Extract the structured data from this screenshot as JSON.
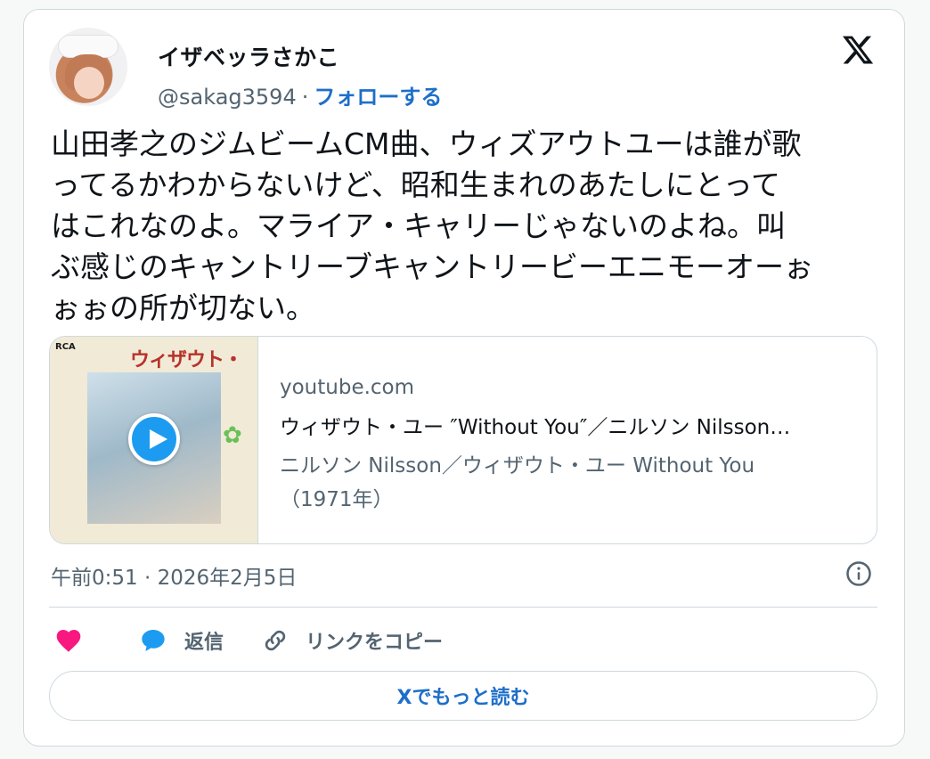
{
  "author": {
    "display_name": "イザベッラさかこ",
    "handle": "@sakag3594",
    "separator": "·",
    "follow_label": "フォローする"
  },
  "tweet": {
    "text": "山田孝之のジムビームCM曲、ウィズアウトユーは誰が歌\nってるかわからないけど、昭和生まれのあたしにとって\nはこれなのよ。マライア・キャリーじゃないのよね。叫\nぶ感じのキャントリーブキャントリービーエニモーオーぉ\nぉぉの所が切ない。",
    "timestamp": "午前0:51 · 2026年2月5日"
  },
  "link_card": {
    "domain": "youtube.com",
    "title": "ウィザウト・ユー ″Without You″／ニルソン Nilsson…",
    "description": "ニルソン Nilsson／ウィザウト・ユー Without You\n（1971年）",
    "thumbnail": {
      "label": "RCA",
      "art_title": "ウィザウト・ユー"
    }
  },
  "actions": {
    "reply_label": "返信",
    "copy_link_label": "リンクをコピー",
    "read_more_label": "Xでもっと読む"
  },
  "icons": {
    "like": "heart-icon",
    "reply": "reply-bubble-icon",
    "copy": "link-icon",
    "info": "info-icon",
    "brand": "x-logo-icon",
    "play": "play-icon"
  },
  "colors": {
    "like": "#f91880",
    "reply": "#1d9bf0",
    "link": "#1d6fc9",
    "muted": "#536471",
    "border": "#cfd9de"
  }
}
